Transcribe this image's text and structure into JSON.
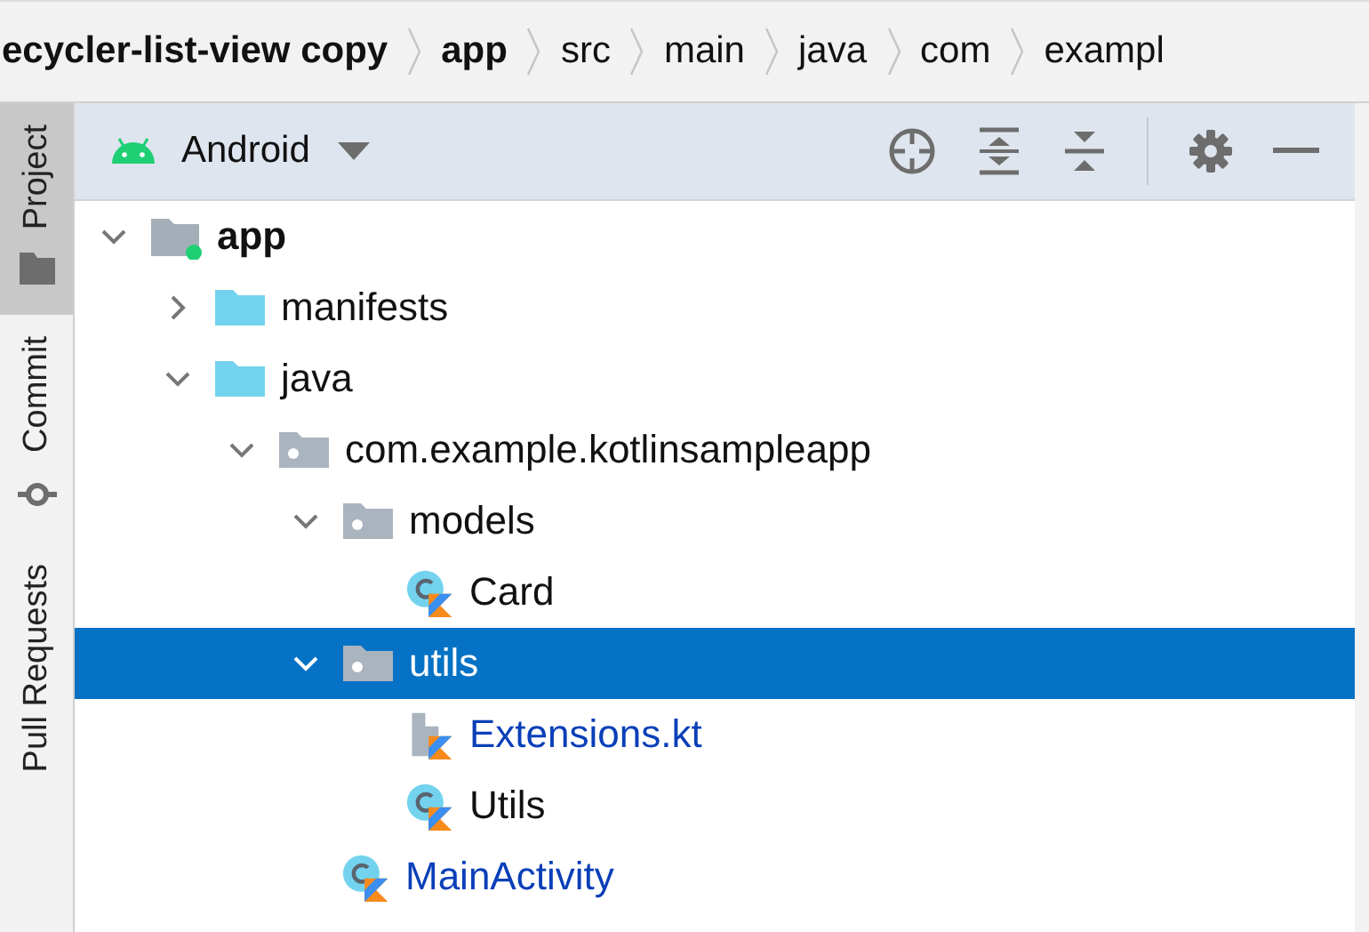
{
  "breadcrumbs": [
    {
      "label": "ecycler-list-view copy",
      "kind": "project"
    },
    {
      "label": "app",
      "kind": "module"
    },
    {
      "label": "src",
      "kind": "dir"
    },
    {
      "label": "main",
      "kind": "dir"
    },
    {
      "label": "java",
      "kind": "dir"
    },
    {
      "label": "com",
      "kind": "dir"
    },
    {
      "label": "exampl",
      "kind": "dir"
    }
  ],
  "tool_strip": [
    {
      "label": "Project",
      "kind": "project",
      "selected": true
    },
    {
      "label": "Commit",
      "kind": "commit",
      "selected": false
    },
    {
      "label": "Pull Requests",
      "kind": "pull_requests",
      "selected": false
    }
  ],
  "panel": {
    "view_selector": "Android"
  },
  "tree": [
    {
      "label": "app",
      "kind": "module",
      "expanded": true,
      "selected": false,
      "modified": false,
      "children": [
        {
          "label": "manifests",
          "kind": "folder",
          "expanded": false,
          "selected": false,
          "modified": false
        },
        {
          "label": "java",
          "kind": "folder",
          "expanded": true,
          "selected": false,
          "modified": false,
          "children": [
            {
              "label": "com.example.kotlinsampleapp",
              "kind": "package",
              "expanded": true,
              "selected": false,
              "modified": false,
              "children": [
                {
                  "label": "models",
                  "kind": "package",
                  "expanded": true,
                  "selected": false,
                  "modified": false,
                  "children": [
                    {
                      "label": "Card",
                      "kind": "class",
                      "selected": false,
                      "modified": false
                    }
                  ]
                },
                {
                  "label": "utils",
                  "kind": "package",
                  "expanded": true,
                  "selected": true,
                  "modified": false,
                  "children": [
                    {
                      "label": "Extensions.kt",
                      "kind": "file",
                      "selected": false,
                      "modified": true
                    },
                    {
                      "label": "Utils",
                      "kind": "class",
                      "selected": false,
                      "modified": false
                    }
                  ]
                },
                {
                  "label": "MainActivity",
                  "kind": "class",
                  "selected": false,
                  "modified": true
                }
              ]
            }
          ]
        }
      ]
    }
  ]
}
